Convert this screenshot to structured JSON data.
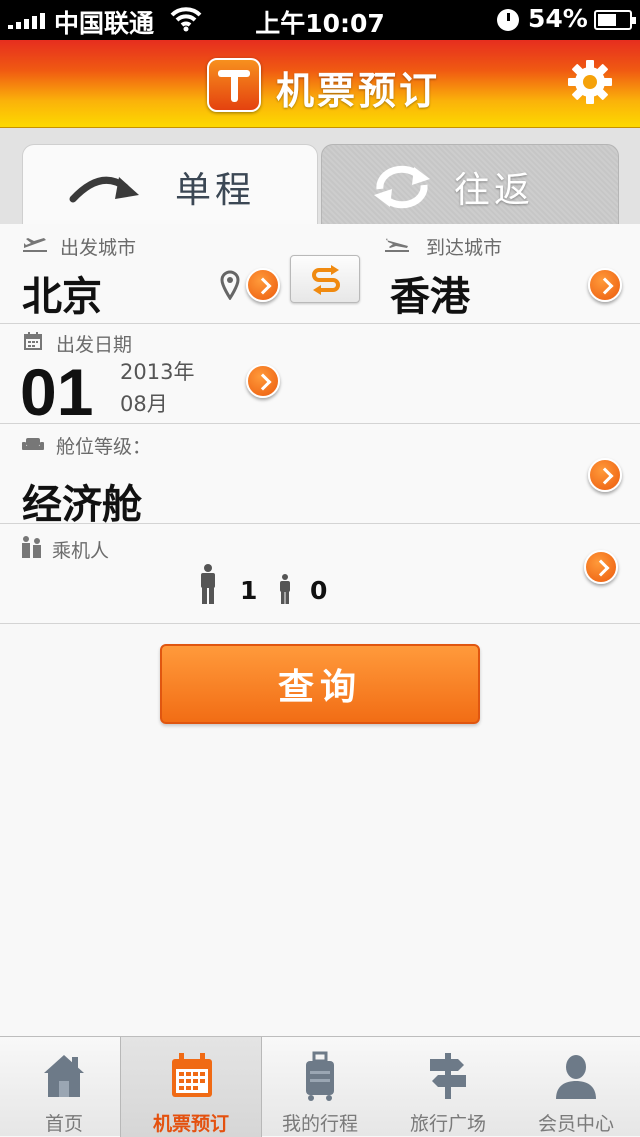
{
  "status": {
    "carrier": "中国联通",
    "time": "上午10:07",
    "battery": "54%"
  },
  "header": {
    "title": "机票预订"
  },
  "tabs": [
    {
      "label": "单程"
    },
    {
      "label": "往返"
    }
  ],
  "departure": {
    "label": "出发城市",
    "city": "北京"
  },
  "arrival": {
    "label": "到达城市",
    "city": "香港"
  },
  "date": {
    "label": "出发日期",
    "day": "01",
    "year": "2013年",
    "month": "08月"
  },
  "cabin": {
    "label": "舱位等级：",
    "value": "经济舱"
  },
  "passengers": {
    "label": "乘机人",
    "adults": "1",
    "children": "0"
  },
  "search_label": "查询",
  "tabbar": [
    {
      "label": "首页"
    },
    {
      "label": "机票预订"
    },
    {
      "label": "我的行程"
    },
    {
      "label": "旅行广场"
    },
    {
      "label": "会员中心"
    }
  ],
  "colors": {
    "accent": "#f26d15",
    "header_top": "#e62e1f",
    "header_bottom": "#fdd900"
  }
}
